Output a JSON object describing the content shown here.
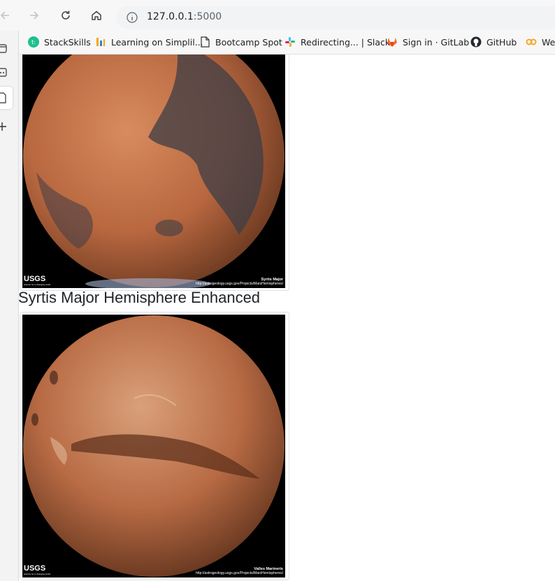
{
  "browser": {
    "url_host": "127.0.0.1",
    "url_port": ":5000"
  },
  "bookmarks": [
    {
      "label": "StackSkills",
      "icon": "stackskills-icon"
    },
    {
      "label": "Learning on Simplil...",
      "icon": "simplilearn-icon"
    },
    {
      "label": "Bootcamp Spot",
      "icon": "page-icon"
    },
    {
      "label": "Redirecting... | Slack",
      "icon": "slack-icon"
    },
    {
      "label": "Sign in · GitLab",
      "icon": "gitlab-icon"
    },
    {
      "label": "GitHub",
      "icon": "github-icon"
    },
    {
      "label": "Wel",
      "icon": "coursera-icon"
    }
  ],
  "hemispheres": [
    {
      "title": "",
      "image_label": "Syrtis Major",
      "usgs": "USGS",
      "usgs_tagline": "science for a changing world",
      "credit_url": "http://astrogeology.usgs.gov/Projects/MarsHemispheres/"
    },
    {
      "title": "Syrtis Major Hemisphere Enhanced",
      "image_label": "Valles Marineris",
      "usgs": "USGS",
      "usgs_tagline": "science for a changing world",
      "credit_url": "http://astrogeology.usgs.gov/Projects/MarsHemispheres/"
    }
  ]
}
